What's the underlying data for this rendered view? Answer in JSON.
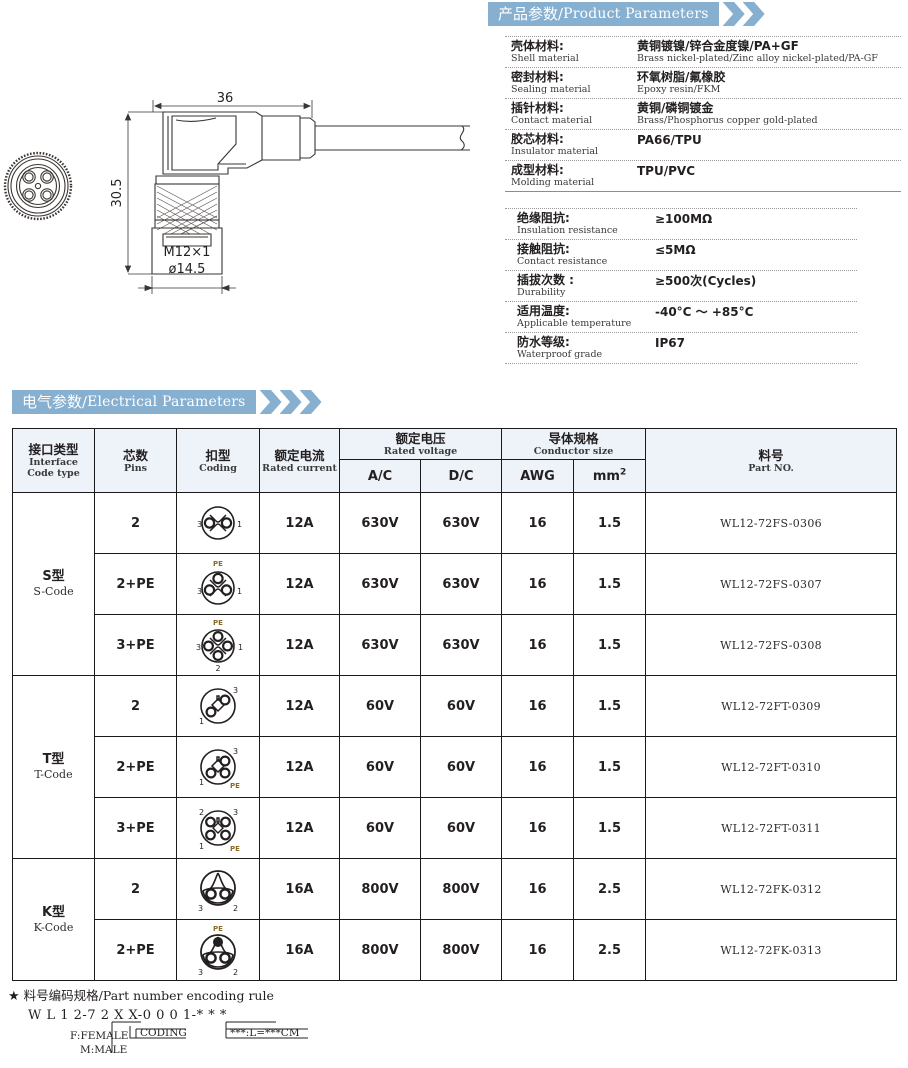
{
  "sections": {
    "product_parameters": {
      "zh": "产品参数",
      "sep": "/",
      "en": "Product Parameters"
    },
    "electrical_parameters": {
      "zh": "电气参数",
      "sep": "/",
      "en": "Electrical Parameters"
    }
  },
  "drawing": {
    "dim_length": "36",
    "dim_height": "30.5",
    "dim_thread": "M12×1",
    "dim_diameter": "ø14.5"
  },
  "material_specs": [
    {
      "label_zh": "壳体材料:",
      "label_en": "Shell material",
      "value_zh": "黄铜镀镍/锌合金度镍/PA+GF",
      "value_en": "Brass nickel-plated/Zinc alloy nickel-plated/PA-GF"
    },
    {
      "label_zh": "密封材料:",
      "label_en": "Sealing material",
      "value_zh": "环氧树脂/氟橡胶",
      "value_en": "Epoxy resin/FKM"
    },
    {
      "label_zh": "插针材料:",
      "label_en": "Contact material",
      "value_zh": "黄铜/磷铜镀金",
      "value_en": "Brass/Phosphorus copper gold-plated"
    },
    {
      "label_zh": "胶芯材料:",
      "label_en": "Insulator material",
      "value_zh": "PA66/TPU",
      "value_en": ""
    },
    {
      "label_zh": "成型材料:",
      "label_en": "Molding material",
      "value_zh": "TPU/PVC",
      "value_en": ""
    }
  ],
  "electrical_specs": [
    {
      "label_zh": "绝缘阻抗:",
      "label_en": "Insulation resistance",
      "value": "≥100MΩ"
    },
    {
      "label_zh": "接触阻抗:",
      "label_en": "Contact resistance",
      "value": "≤5MΩ"
    },
    {
      "label_zh": "插拔次数 :",
      "label_en": "Durability",
      "value": "≥500次(Cycles)"
    },
    {
      "label_zh": "适用温度:",
      "label_en": "Applicable temperature",
      "value": "-40°C ～ +85°C"
    },
    {
      "label_zh": "防水等级:",
      "label_en": "Waterproof grade",
      "value": "IP67"
    }
  ],
  "table": {
    "headers": {
      "interface": {
        "zh": "接口类型",
        "en": "Interface",
        "en2": "Code  type"
      },
      "pins": {
        "zh": "芯数",
        "en": "Pins"
      },
      "coding": {
        "zh": "扣型",
        "en": "Coding"
      },
      "rated_current": {
        "zh": "额定电流",
        "en": "Rated current"
      },
      "rated_voltage": {
        "zh": "额定电压",
        "en": "Rated voltage"
      },
      "ac": "A/C",
      "dc": "D/C",
      "conductor_size": {
        "zh": "导体规格",
        "en": "Conductor size"
      },
      "awg": "AWG",
      "mm2": "mm",
      "mm2_sup": "2",
      "part_no": {
        "zh": "料号",
        "en": "Part NO."
      }
    },
    "groups": [
      {
        "code_zh": "S型",
        "code_en": "S-Code",
        "coding_style": "s",
        "rows": [
          {
            "pins": "2",
            "coding_variant": "s2",
            "current": "12A",
            "ac": "630V",
            "dc": "630V",
            "awg": "16",
            "mm2": "1.5",
            "part_no": "WL12-72FS-0306"
          },
          {
            "pins": "2+PE",
            "coding_variant": "s2pe",
            "current": "12A",
            "ac": "630V",
            "dc": "630V",
            "awg": "16",
            "mm2": "1.5",
            "part_no": "WL12-72FS-0307"
          },
          {
            "pins": "3+PE",
            "coding_variant": "s3pe",
            "current": "12A",
            "ac": "630V",
            "dc": "630V",
            "awg": "16",
            "mm2": "1.5",
            "part_no": "WL12-72FS-0308"
          }
        ]
      },
      {
        "code_zh": "T型",
        "code_en": "T-Code",
        "coding_style": "t",
        "rows": [
          {
            "pins": "2",
            "coding_variant": "t2",
            "current": "12A",
            "ac": "60V",
            "dc": "60V",
            "awg": "16",
            "mm2": "1.5",
            "part_no": "WL12-72FT-0309"
          },
          {
            "pins": "2+PE",
            "coding_variant": "t2pe",
            "current": "12A",
            "ac": "60V",
            "dc": "60V",
            "awg": "16",
            "mm2": "1.5",
            "part_no": "WL12-72FT-0310"
          },
          {
            "pins": "3+PE",
            "coding_variant": "t3pe",
            "current": "12A",
            "ac": "60V",
            "dc": "60V",
            "awg": "16",
            "mm2": "1.5",
            "part_no": "WL12-72FT-0311"
          }
        ]
      },
      {
        "code_zh": "K型",
        "code_en": "K-Code",
        "coding_style": "k",
        "rows": [
          {
            "pins": "2",
            "coding_variant": "k2",
            "current": "16A",
            "ac": "800V",
            "dc": "800V",
            "awg": "16",
            "mm2": "2.5",
            "part_no": "WL12-72FK-0312"
          },
          {
            "pins": "2+PE",
            "coding_variant": "k2pe",
            "current": "16A",
            "ac": "800V",
            "dc": "800V",
            "awg": "16",
            "mm2": "2.5",
            "part_no": "WL12-72FK-0313"
          }
        ]
      }
    ]
  },
  "encoding_rule": {
    "star": "★",
    "title_zh": "料号编码规格",
    "title_sep": "/",
    "title_en": "Part number encoding rule",
    "pattern": "W L 1 2-7 2 X X-0 0 0 1-* * *",
    "note_female": "F:FEMALE",
    "note_male": "M:MALE",
    "note_coding": "CODING",
    "note_length": "***:L=***CM"
  },
  "colors": {
    "banner": "#86afd0",
    "table_header_bg": "#edf3f9",
    "line": "#1a1a1a",
    "pe_label": "#8a6a28"
  }
}
